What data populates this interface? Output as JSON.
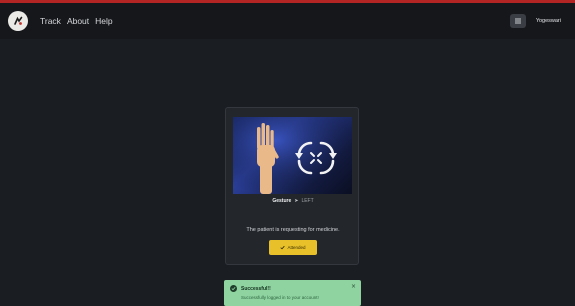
{
  "nav": {
    "logo_icon": "brand-logo-icon",
    "links": [
      "Track",
      "About",
      "Help"
    ],
    "icon_button": "settings-icon",
    "user": "Yogeswari"
  },
  "card": {
    "image_icon": "hand-gesture-image",
    "gesture_label": "Gesture",
    "gesture_arrow": "➤",
    "gesture_value": "LEFT",
    "message": "The patient is requesting for medicine.",
    "button_label": "Attended",
    "button_icon": "check-icon"
  },
  "toast": {
    "title": "Successful!!",
    "body": "Successfully logged in to your account!",
    "close": "×",
    "icon": "check-circle-icon"
  },
  "colors": {
    "accent_bar": "#b32424",
    "button": "#e8c12a",
    "toast": "#8fd3a0",
    "background": "#1a1d22"
  }
}
